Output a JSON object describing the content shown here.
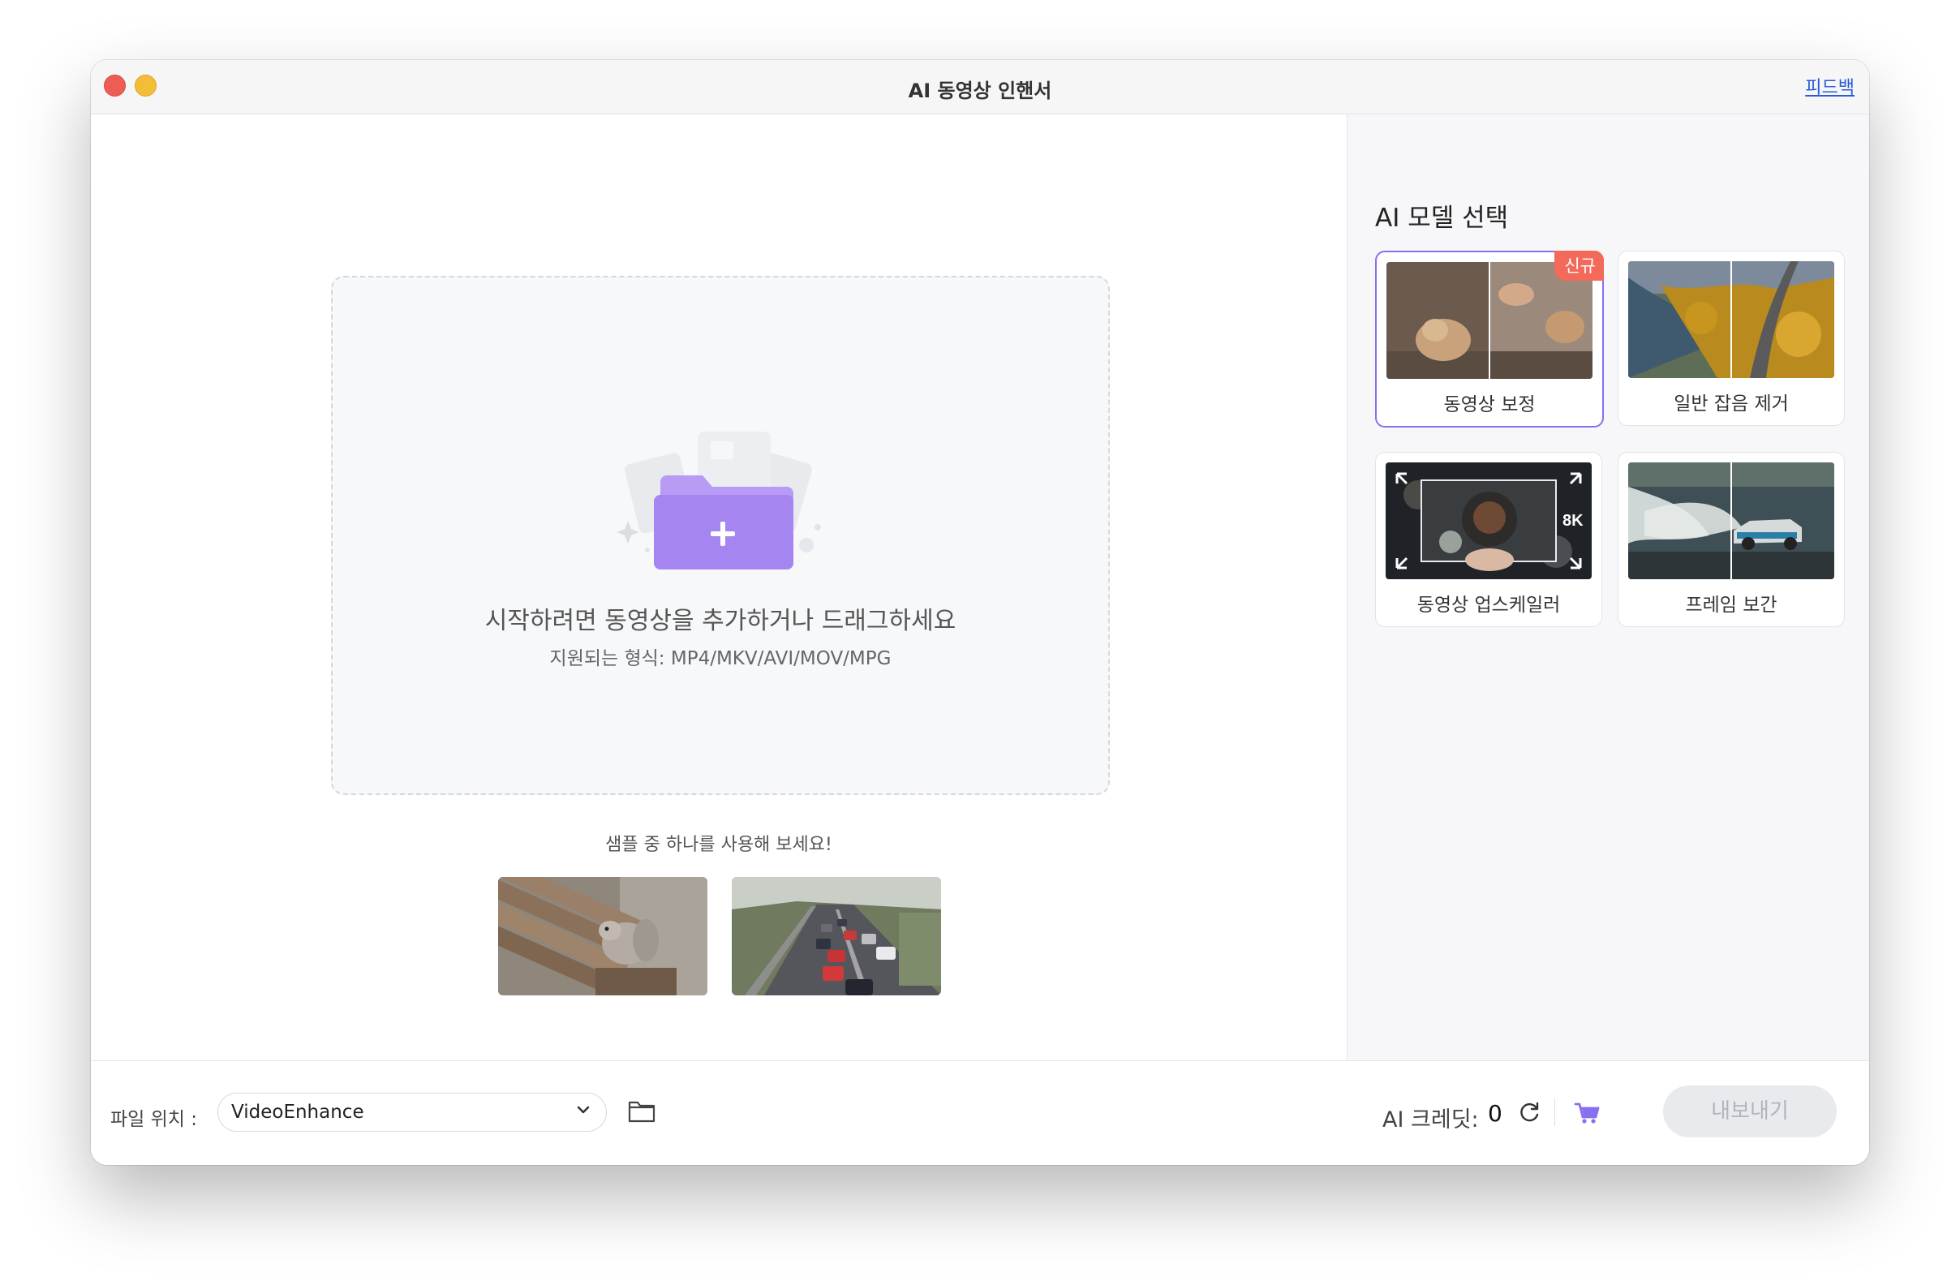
{
  "window": {
    "title": "AI 동영상 인핸서",
    "feedback_link": "피드백"
  },
  "dropzone": {
    "title": "시작하려면 동영상을 추가하거나 드래그하세요",
    "formats": "지원되는 형식: MP4/MKV/AVI/MOV/MPG",
    "icon": "folder-add-icon"
  },
  "samples": {
    "label": "샘플 중 하나를 사용해 보세요!",
    "items": [
      {
        "subject": "squirrel-on-bench"
      },
      {
        "subject": "highway-traffic"
      }
    ]
  },
  "sidebar": {
    "title": "AI 모델 선택",
    "models": [
      {
        "label": "동영상 보정",
        "badge": "신규",
        "selected": true
      },
      {
        "label": "일반 잡음 제거",
        "selected": false
      },
      {
        "label": "동영상 업스케일러",
        "overlay_text": "8K",
        "selected": false
      },
      {
        "label": "프레임 보간",
        "selected": false
      }
    ]
  },
  "footer": {
    "location_label": "파일 위치 :",
    "location_value": "VideoEnhance",
    "credit_label": "AI 크레딧:",
    "credit_value": "0",
    "export_label": "내보내기"
  },
  "colors": {
    "accent": "#8a6ef2",
    "badge": "#f36a5b",
    "link": "#2a5ad8",
    "folder": "#a585f0"
  }
}
